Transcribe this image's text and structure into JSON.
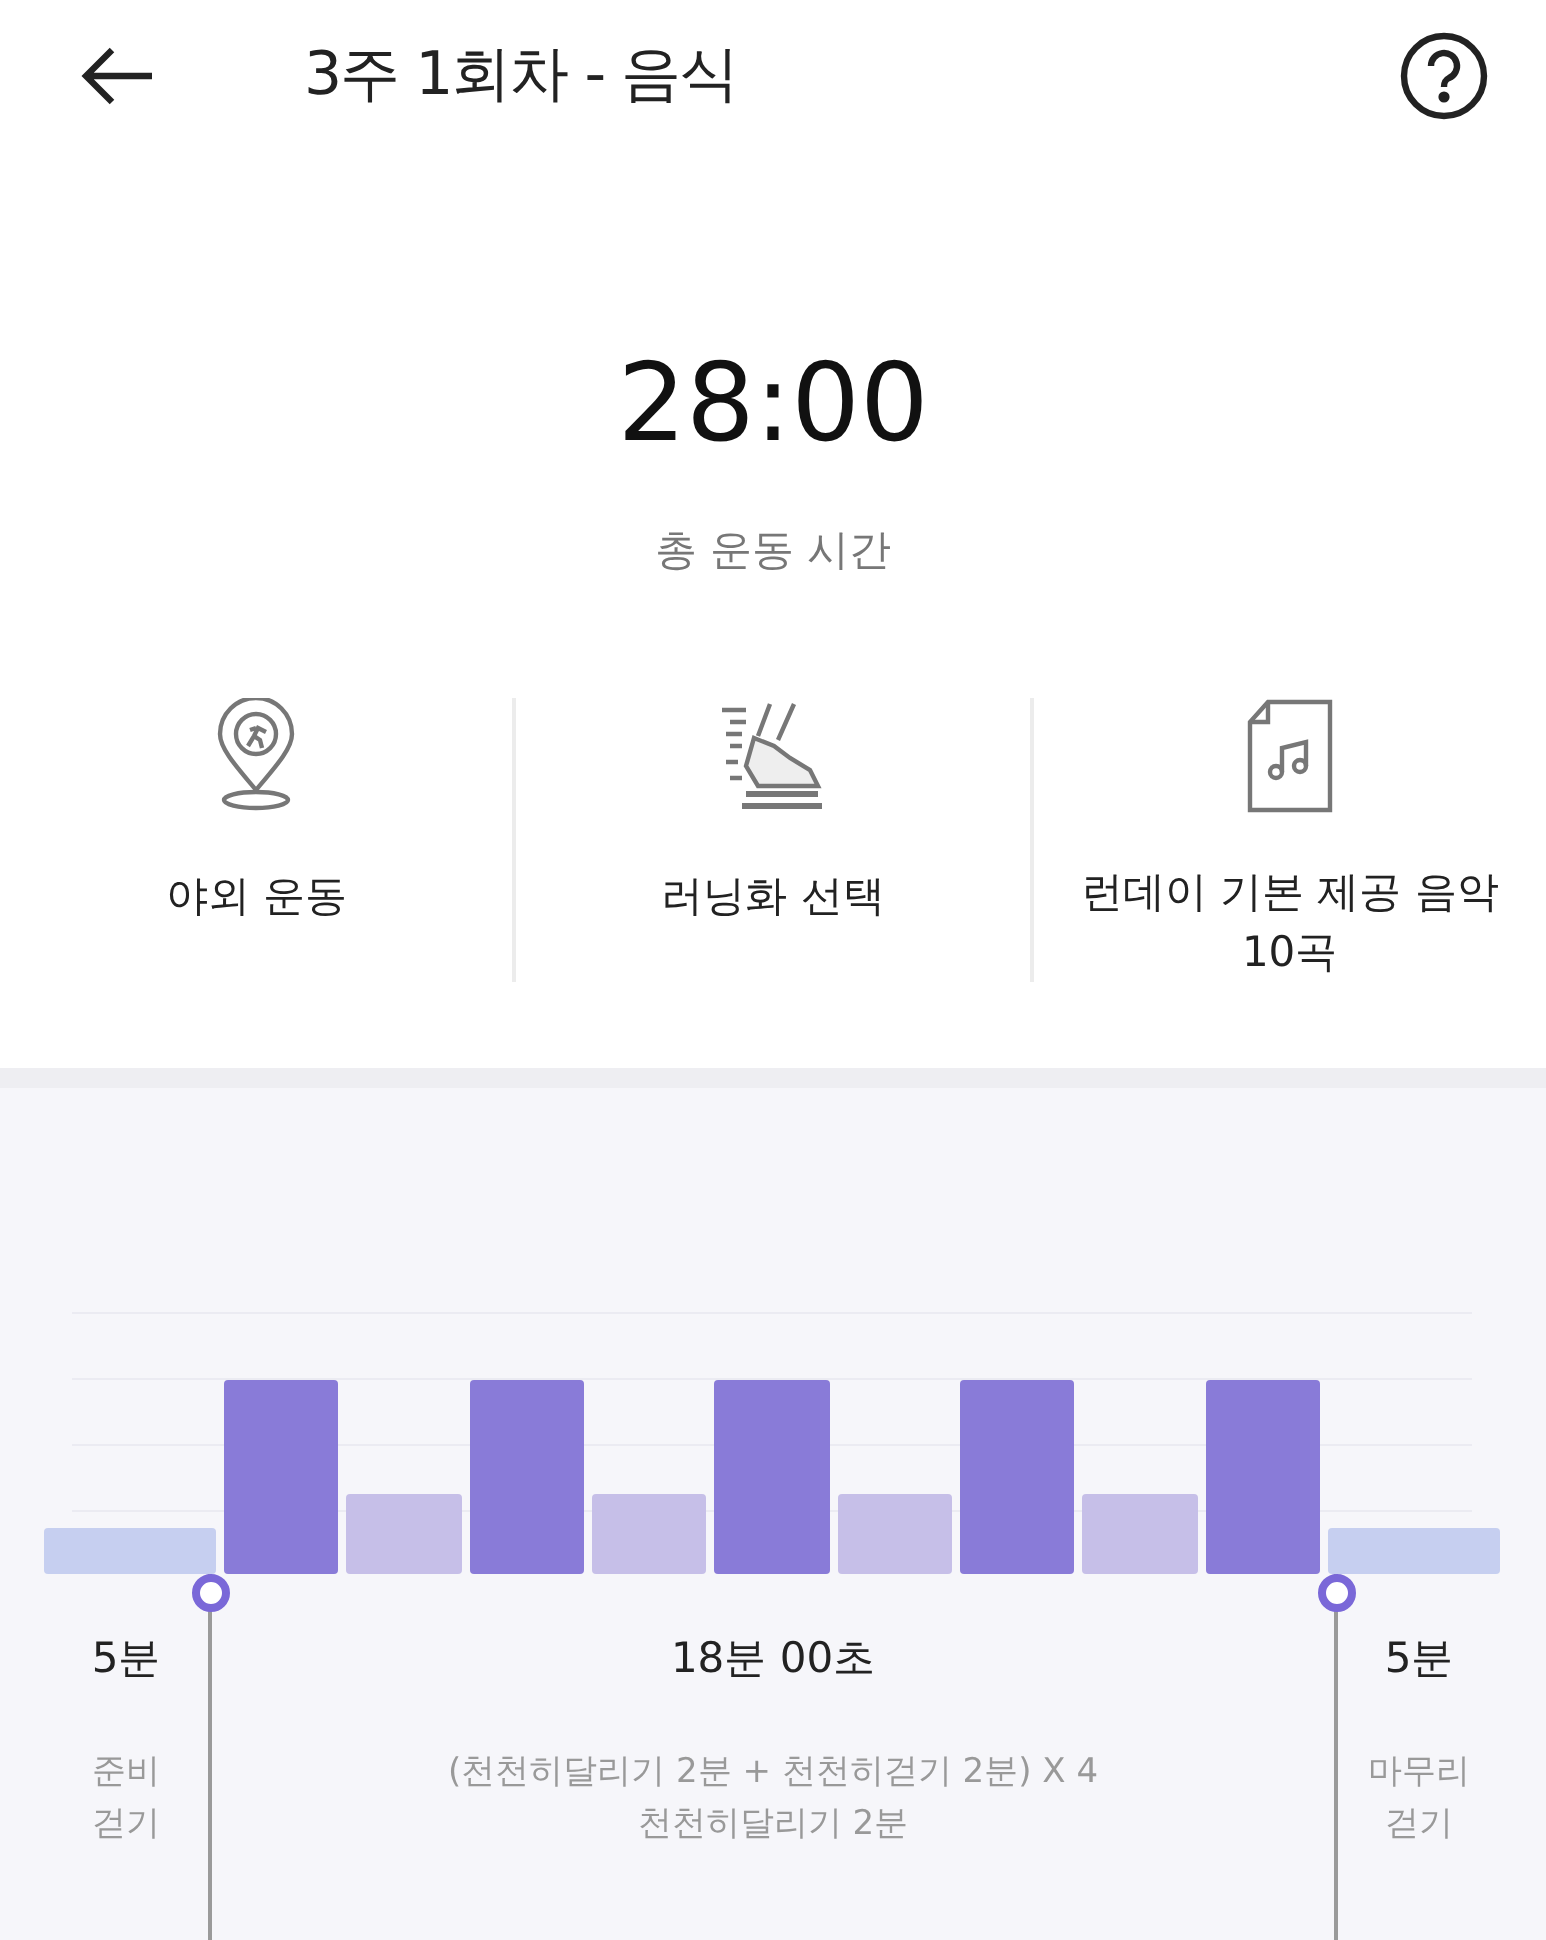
{
  "header": {
    "title": "3주 1회차 - 음식"
  },
  "summary": {
    "time": "28:00",
    "caption": "총 운동 시간"
  },
  "options": [
    {
      "kind": "location",
      "label": "야외 운동"
    },
    {
      "kind": "shoe",
      "label": "러닝화 선택"
    },
    {
      "kind": "music",
      "label": "런데이 기본 제공 음악\n10곡"
    }
  ],
  "workout": {
    "segments": [
      {
        "kind": "warmup"
      },
      {
        "kind": "run"
      },
      {
        "kind": "walk"
      },
      {
        "kind": "run"
      },
      {
        "kind": "walk"
      },
      {
        "kind": "run"
      },
      {
        "kind": "walk"
      },
      {
        "kind": "run"
      },
      {
        "kind": "walk"
      },
      {
        "kind": "run"
      },
      {
        "kind": "cooldown"
      }
    ],
    "phases": [
      {
        "duration": "5분",
        "description": "준비\n걷기"
      },
      {
        "duration": "18분 00초",
        "description": "(천천히달리기 2분 + 천천히걷기 2분) X 4\n천천히달리기 2분"
      },
      {
        "duration": "5분",
        "description": "마무리\n걷기"
      }
    ]
  }
}
